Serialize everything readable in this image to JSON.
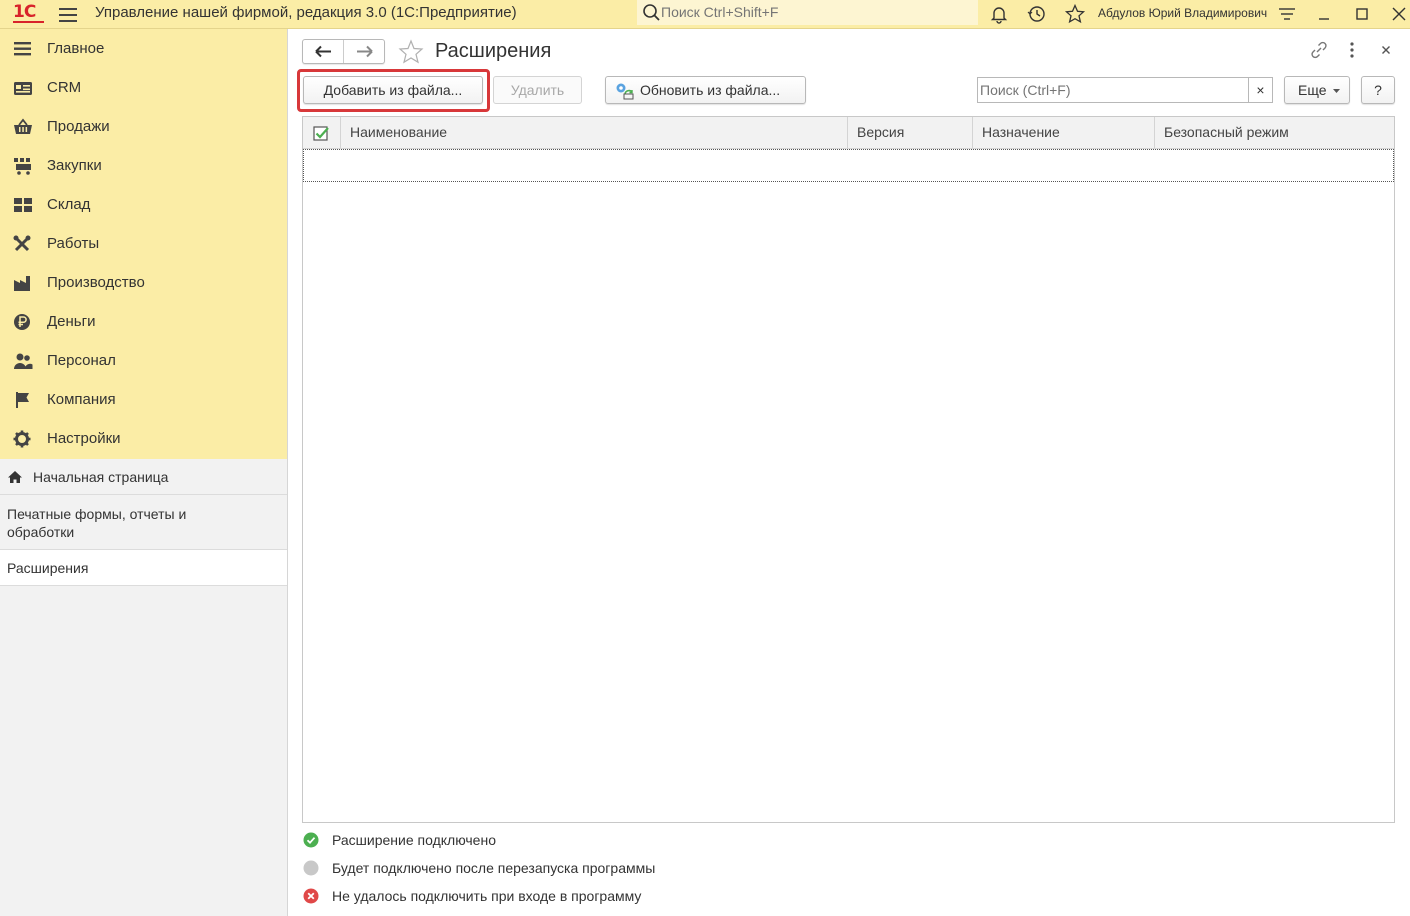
{
  "app": {
    "logo": "1С",
    "title": "Управление нашей фирмой, редакция 3.0  (1С:Предприятие)",
    "search_placeholder": "Поиск Ctrl+Shift+F",
    "user": "Абдулов Юрий Владимирович"
  },
  "sidebar": {
    "sections": [
      {
        "label": "Главное",
        "icon": "menu-lines-icon"
      },
      {
        "label": "CRM",
        "icon": "crm-card-icon"
      },
      {
        "label": "Продажи",
        "icon": "shopping-basket-icon"
      },
      {
        "label": "Закупки",
        "icon": "cart-icon"
      },
      {
        "label": "Склад",
        "icon": "warehouse-grid-icon"
      },
      {
        "label": "Работы",
        "icon": "tools-icon"
      },
      {
        "label": "Производство",
        "icon": "factory-icon"
      },
      {
        "label": "Деньги",
        "icon": "ruble-coin-icon"
      },
      {
        "label": "Персонал",
        "icon": "people-icon"
      },
      {
        "label": "Компания",
        "icon": "flag-icon"
      },
      {
        "label": "Настройки",
        "icon": "gear-icon"
      }
    ],
    "links": {
      "home": "Начальная страница",
      "print": "Печатные формы, отчеты и обработки",
      "extensions": "Расширения"
    }
  },
  "form": {
    "title": "Расширения",
    "toolbar": {
      "add_from_file": "Добавить из файла...",
      "delete": "Удалить",
      "update_from_file": "Обновить из файла...",
      "search_placeholder": "Поиск (Ctrl+F)",
      "clear": "×",
      "more": "Еще",
      "help": "?"
    },
    "table": {
      "columns": [
        "Наименование",
        "Версия",
        "Назначение",
        "Безопасный режим"
      ],
      "rows": []
    },
    "legend": [
      {
        "text": "Расширение подключено",
        "color": "#4caf50"
      },
      {
        "text": "Будет подключено после перезапуска программы",
        "color": "#c8c8c8"
      },
      {
        "text": "Не удалось подключить при входе в программу",
        "color": "#e04848"
      }
    ]
  },
  "colors": {
    "accent_yellow": "#fbeda6",
    "highlight_red": "#d8383a",
    "logo_red": "#d8232a"
  }
}
